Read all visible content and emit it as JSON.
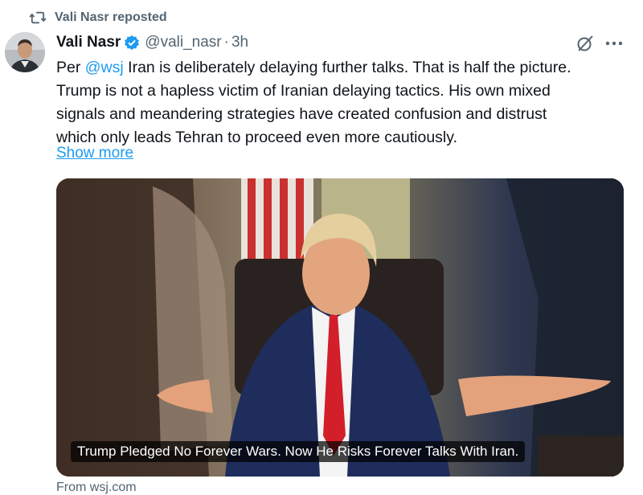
{
  "repost": {
    "label": "Vali Nasr reposted",
    "icon": "repost-icon"
  },
  "author": {
    "name": "Vali Nasr",
    "handle": "@vali_nasr",
    "separator": "·",
    "time": "3h",
    "verified_color": "#1d9bf0"
  },
  "tweet": {
    "line1_prefix": "Per ",
    "mention": "@wsj",
    "line1_suffix": " Iran is deliberately delaying further talks. That is half the picture.",
    "line2": "Trump is not a hapless victim of Iranian delaying tactics. His own mixed",
    "line3": "signals and meandering strategies have created confusion and distrust",
    "line4": "which only leads Tehran to proceed even more cautiously.",
    "show_more": "Show more"
  },
  "card": {
    "caption": "Trump Pledged No Forever Wars. Now He Risks Forever Talks With Iran.",
    "source": "From wsj.com"
  },
  "icons": {
    "grok": "grok-icon",
    "more": "more-options-icon"
  },
  "colors": {
    "link": "#1d9bf0",
    "secondary": "#536471",
    "text": "#0f1419"
  }
}
